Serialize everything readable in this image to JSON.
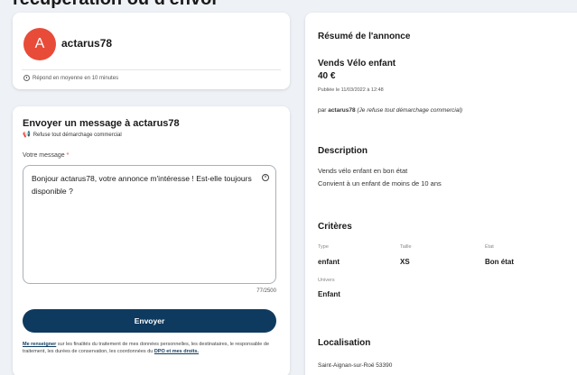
{
  "page": {
    "heading": "récupération ou d'envoi"
  },
  "seller": {
    "avatar_initial": "A",
    "name": "actarus78",
    "response_time": "Répond en moyenne en 10 minutes"
  },
  "message": {
    "title": "Envoyer un message à actarus78",
    "no_commercial": "Refuse tout démarchage commercial",
    "label": "Votre message",
    "required_mark": "*",
    "value": "Bonjour actarus78, votre annonce m'intéresse ! Est-elle toujours disponible ?",
    "char_count": "77/2500",
    "send_label": "Envoyer",
    "legal_link": "Me renseigner",
    "legal_text": " sur les finalités du traitement de mes données personnelles, les destinataires, le responsable de traitement, les durées de conservation, les coordonnées du ",
    "legal_link2": "DPO et mes droits."
  },
  "summary": {
    "title": "Résumé de l'annonce",
    "ad_title": "Vends Vélo enfant",
    "price": "40 €",
    "published": "Publiée le 11/03/2022 à 12:48",
    "by_prefix": "par ",
    "by_user": "actarus78",
    "by_note": " (Je refuse tout démarchage commercial)",
    "description_heading": "Description",
    "description_lines": [
      "Vends vélo enfant en bon état",
      "Convient à un enfant de moins de 10 ans"
    ],
    "criteria_heading": "Critères",
    "criteria": {
      "type_label": "Type",
      "type_value": "enfant",
      "size_label": "Taille",
      "size_value": "XS",
      "state_label": "État",
      "state_value": "Bon état",
      "universe_label": "Univers",
      "universe_value": "Enfant"
    },
    "location_heading": "Localisation",
    "location_value": "Saint-Aignan-sur-Roë 53390"
  },
  "colors": {
    "avatar": "#e84b38",
    "primary_button": "#0e3a5f",
    "background": "#eef1f5"
  }
}
